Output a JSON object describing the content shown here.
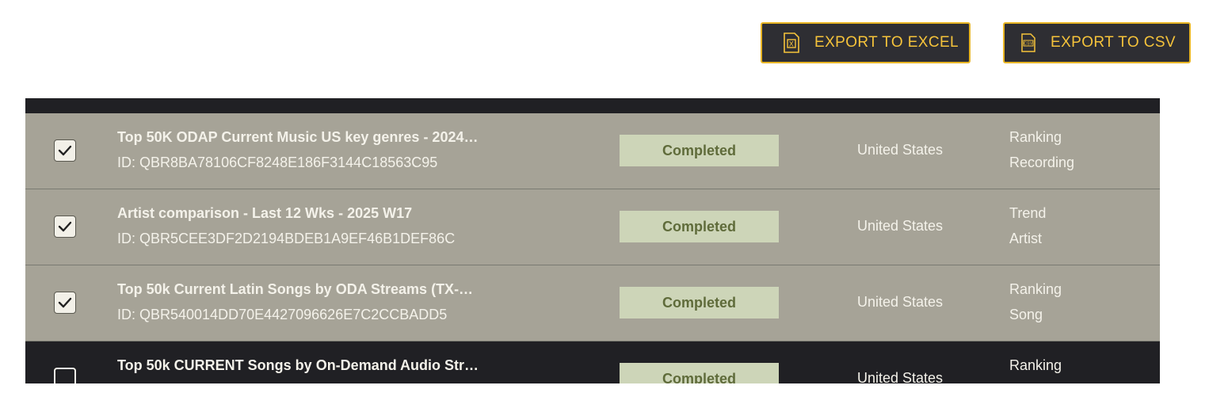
{
  "toolbar": {
    "export_excel_label": "EXPORT TO EXCEL",
    "export_csv_label": "EXPORT TO CSV",
    "excel_icon": "excel-file-icon",
    "csv_icon": "csv-file-icon",
    "csv_icon_text": "CSV",
    "excel_icon_text": "X",
    "accent_color": "#f5c33b"
  },
  "table": {
    "rows": [
      {
        "checked": true,
        "title": "Top 50K ODAP Current Music US key genres - 2024…",
        "id": "ID: QBR8BA78106CF8248E186F3144C18563C95",
        "status": "Completed",
        "country": "United States",
        "type": "Ranking",
        "subtype": "Recording"
      },
      {
        "checked": true,
        "title": "Artist comparison - Last 12 Wks - 2025 W17",
        "id": "ID: QBR5CEE3DF2D2194BDEB1A9EF46B1DEF86C",
        "status": "Completed",
        "country": "United States",
        "type": "Trend",
        "subtype": "Artist"
      },
      {
        "checked": true,
        "title": "Top 50k Current Latin Songs by ODA Streams (TX-…",
        "id": "ID: QBR540014DD70E4427096626E7C2CCBADD5",
        "status": "Completed",
        "country": "United States",
        "type": "Ranking",
        "subtype": "Song"
      },
      {
        "checked": false,
        "title": "Top 50k CURRENT Songs by On-Demand Audio Str…",
        "id": "",
        "status": "Completed",
        "country": "United States",
        "type": "Ranking",
        "subtype": ""
      }
    ]
  },
  "colors": {
    "selected_row": "#a6a397",
    "dark_row": "#202024",
    "status_bg": "#cdd5b8",
    "status_text": "#5f6b3a"
  }
}
